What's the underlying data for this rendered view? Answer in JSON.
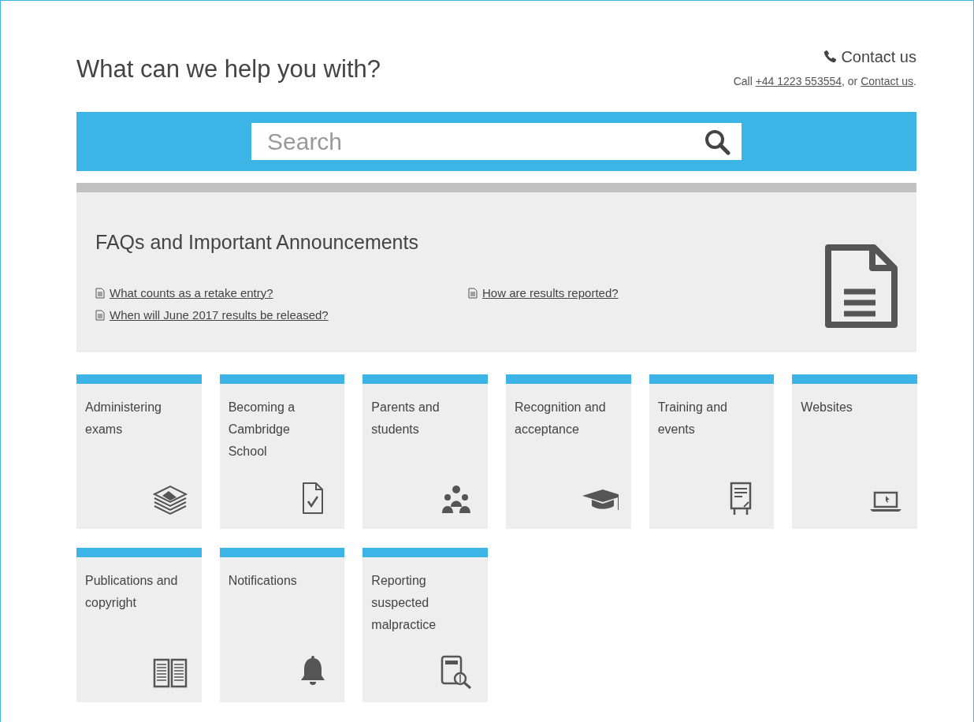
{
  "heading": "What can we help you with?",
  "contact": {
    "title": "Contact us",
    "prefix": "Call ",
    "phone": "+44 1223 553554",
    "middle": ", or ",
    "link": "Contact us",
    "suffix": "."
  },
  "search": {
    "placeholder": "Search"
  },
  "faq": {
    "title": "FAQs and Important Announcements",
    "columns": [
      [
        "What counts as a retake entry?",
        "When will June 2017 results be released?"
      ],
      [
        "How are results reported?"
      ]
    ]
  },
  "tiles": [
    {
      "label": "Administering exams"
    },
    {
      "label": "Becoming a Cambridge School"
    },
    {
      "label": "Parents and students"
    },
    {
      "label": "Recognition and acceptance"
    },
    {
      "label": "Training and events"
    },
    {
      "label": "Websites"
    },
    {
      "label": "Publications and copyright"
    },
    {
      "label": "Notifications"
    },
    {
      "label": "Reporting suspected malpractice"
    }
  ]
}
